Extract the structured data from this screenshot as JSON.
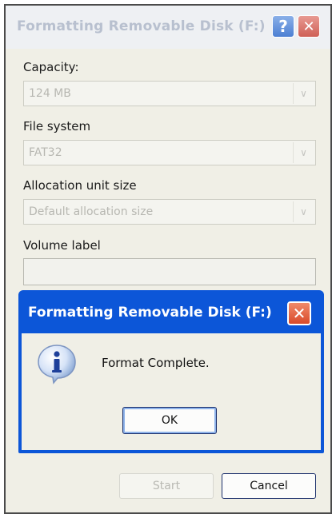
{
  "window": {
    "title": "Formatting Removable Disk (F:)",
    "help_glyph": "?",
    "close_glyph": "✕"
  },
  "fields": {
    "capacity_label": "Capacity:",
    "capacity_value": "124 MB",
    "filesystem_label": "File system",
    "filesystem_value": "FAT32",
    "allocation_label": "Allocation unit size",
    "allocation_value": "Default allocation size",
    "volume_label": "Volume label",
    "volume_value": ""
  },
  "message_box": {
    "title": "Formatting Removable Disk (F:)",
    "close_glyph": "✕",
    "text": "Format Complete.",
    "ok_label": "OK",
    "icon": "info-icon"
  },
  "buttons": {
    "start_label": "Start",
    "cancel_label": "Cancel"
  },
  "colors": {
    "dialog_title_active": "#0c56d8",
    "dialog_title_inactive": "#eef0f3",
    "window_bg": "#f0efe6"
  }
}
